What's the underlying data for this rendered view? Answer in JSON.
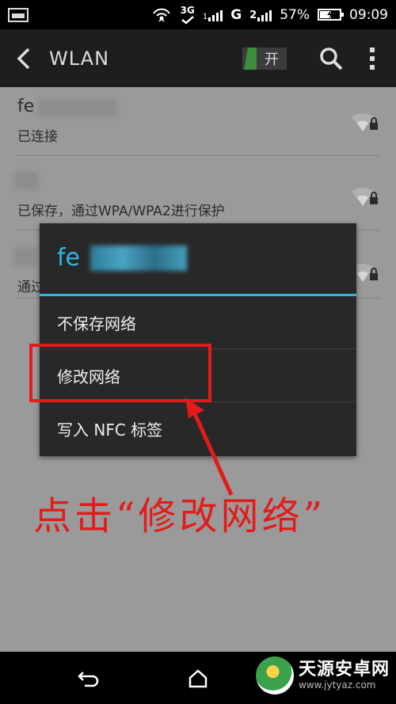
{
  "status_bar": {
    "network_3g": "3G",
    "network_g": "G",
    "network_2": "2",
    "battery": "57%",
    "battery_level": 0.57,
    "time": "09:09"
  },
  "action_bar": {
    "title": "WLAN",
    "toggle_label": "开",
    "toggle_on": true
  },
  "networks": [
    {
      "name": "fe",
      "status": "已连接"
    },
    {
      "name": "",
      "status": "已保存，通过WPA/WPA2进行保护"
    },
    {
      "name": "",
      "status": "通过"
    }
  ],
  "dialog": {
    "title": "fe",
    "items": [
      "不保存网络",
      "修改网络",
      "写入 NFC 标签"
    ]
  },
  "annotation": {
    "text": "点击“修改网络”",
    "color": "#e31b1b"
  },
  "watermark": {
    "name": "天源安卓网",
    "url": "www.jytyaz.com"
  },
  "colors": {
    "accent": "#33b5e5",
    "toggle_on": "#3b8c3b"
  }
}
